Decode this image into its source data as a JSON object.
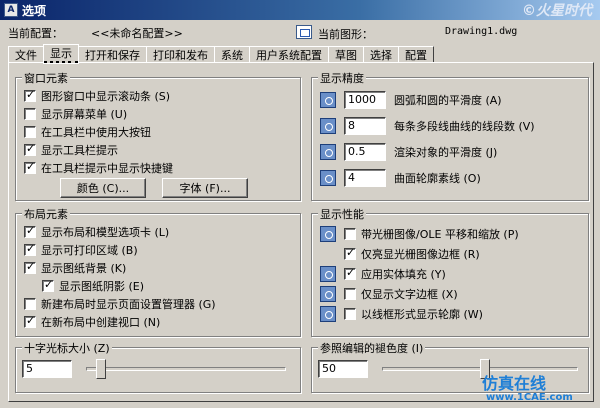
{
  "window": {
    "title": "选项",
    "watermark": "©火星时代"
  },
  "info": {
    "current_profile_label": "当前配置：",
    "current_profile_value": "<<未命名配置>>",
    "current_drawing_label": "当前图形：",
    "current_drawing_value": "Drawing1.dwg"
  },
  "tabs": [
    {
      "label": "文件"
    },
    {
      "label": "显示"
    },
    {
      "label": "打开和保存"
    },
    {
      "label": "打印和发布"
    },
    {
      "label": "系统"
    },
    {
      "label": "用户系统配置"
    },
    {
      "label": "草图"
    },
    {
      "label": "选择"
    },
    {
      "label": "配置"
    }
  ],
  "window_elements": {
    "title": "窗口元素",
    "items": [
      {
        "label": "图形窗口中显示滚动条 (S)",
        "checked": true
      },
      {
        "label": "显示屏幕菜单 (U)",
        "checked": false
      },
      {
        "label": "在工具栏中使用大按钮",
        "checked": false
      },
      {
        "label": "显示工具栏提示",
        "checked": true
      },
      {
        "label": "在工具栏提示中显示快捷键",
        "checked": true
      }
    ],
    "color_button": "颜色 (C)...",
    "font_button": "字体 (F)..."
  },
  "layout_elements": {
    "title": "布局元素",
    "items": [
      {
        "label": "显示布局和模型选项卡 (L)",
        "checked": true
      },
      {
        "label": "显示可打印区域 (B)",
        "checked": true
      },
      {
        "label": "显示图纸背景 (K)",
        "checked": true
      },
      {
        "label": "显示图纸阴影 (E)",
        "checked": true
      },
      {
        "label": "新建布局时显示页面设置管理器 (G)",
        "checked": false
      },
      {
        "label": "在新布局中创建视口 (N)",
        "checked": true
      }
    ]
  },
  "crosshair": {
    "title": "十字光标大小 (Z)",
    "value": "5",
    "level": 0.05
  },
  "display_resolution": {
    "title": "显示精度",
    "items": [
      {
        "value": "1000",
        "label": "圆弧和圆的平滑度 (A)"
      },
      {
        "value": "8",
        "label": "每条多段线曲线的线段数 (V)"
      },
      {
        "value": "0.5",
        "label": "渲染对象的平滑度 (J)"
      },
      {
        "value": "4",
        "label": "曲面轮廓素线 (O)"
      }
    ]
  },
  "display_performance": {
    "title": "显示性能",
    "items": [
      {
        "label": "带光栅图像/OLE 平移和缩放 (P)",
        "checked": false,
        "icon": true
      },
      {
        "label": "仅亮显光栅图像边框 (R)",
        "checked": true,
        "icon": false
      },
      {
        "label": "应用实体填充 (Y)",
        "checked": true,
        "icon": true
      },
      {
        "label": "仅显示文字边框 (X)",
        "checked": false,
        "icon": true
      },
      {
        "label": "以线框形式显示轮廓 (W)",
        "checked": false,
        "icon": true
      }
    ]
  },
  "xref_fade": {
    "title": "参照编辑的褪色度 (I)",
    "value": "50",
    "level": 0.5
  },
  "watermark2": {
    "line1": "仿真在线",
    "line2": "www.1CAE.com"
  }
}
